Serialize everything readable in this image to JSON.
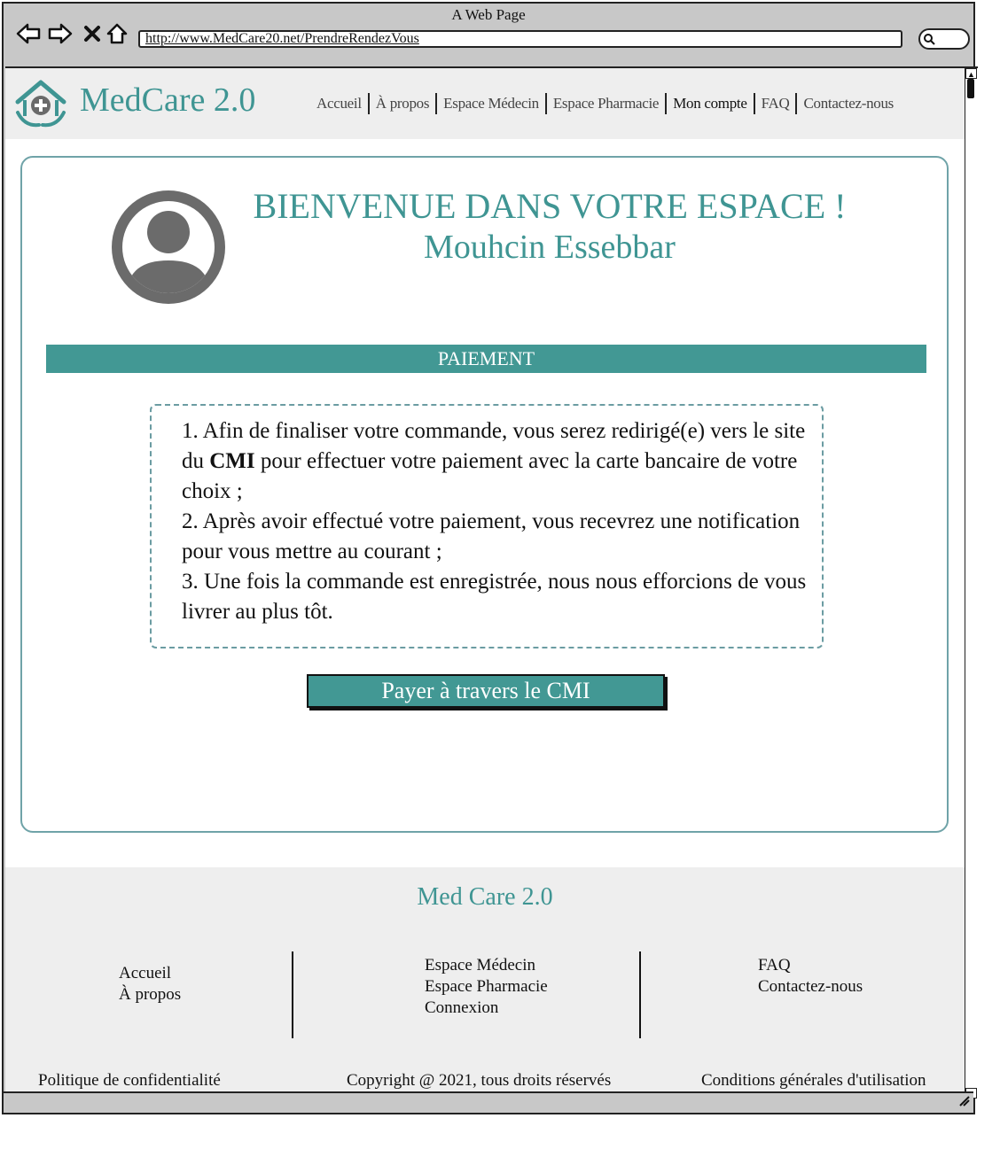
{
  "window": {
    "title": "A Web Page",
    "url": "http://www.MedCare20.net/PrendreRendezVous"
  },
  "header": {
    "brand": "MedCare 2.0",
    "nav": [
      {
        "label": "Accueil"
      },
      {
        "label": "À propos"
      },
      {
        "label": "Espace Médecin"
      },
      {
        "label": "Espace Pharmacie"
      },
      {
        "label": "Mon compte",
        "active": true
      },
      {
        "label": "FAQ"
      },
      {
        "label": "Contactez-nous"
      }
    ]
  },
  "welcome": {
    "title": "BIENVENUE DANS VOTRE ESPACE !",
    "user_name": "Mouhcin Essebbar"
  },
  "section_title": "PAIEMENT",
  "steps": {
    "s1_a": "1. Afin de finaliser votre commande, vous serez redirigé(e) vers le site du ",
    "s1_b": "CMI",
    "s1_c": " pour effectuer votre paiement avec la carte bancaire de votre choix ;",
    "s2": "2. Après avoir effectué votre paiement, vous recevrez une notification pour vous mettre au courant ;",
    "s3": "3. Une fois la commande est enregistrée, nous nous efforcions de vous livrer au plus tôt."
  },
  "pay_button": "Payer à travers le CMI",
  "footer": {
    "brand": "Med Care 2.0",
    "col1": [
      "Accueil",
      "À propos"
    ],
    "col2": [
      "Espace Médecin",
      "Espace Pharmacie",
      "Connexion"
    ],
    "col3": [
      "FAQ",
      "Contactez-nous"
    ],
    "privacy": "Politique de confidentialité",
    "copyright": "Copyright @ 2021, tous droits réservés",
    "terms": "Conditions générales d'utilisation"
  },
  "colors": {
    "accent": "#429894",
    "header_bg": "#eeeeee",
    "card_border": "#6fa3a8"
  },
  "icons": [
    "back-arrow-icon",
    "forward-arrow-icon",
    "close-icon",
    "home-icon",
    "search-icon",
    "medical-home-logo-icon",
    "user-avatar-icon",
    "resize-grip-icon"
  ]
}
